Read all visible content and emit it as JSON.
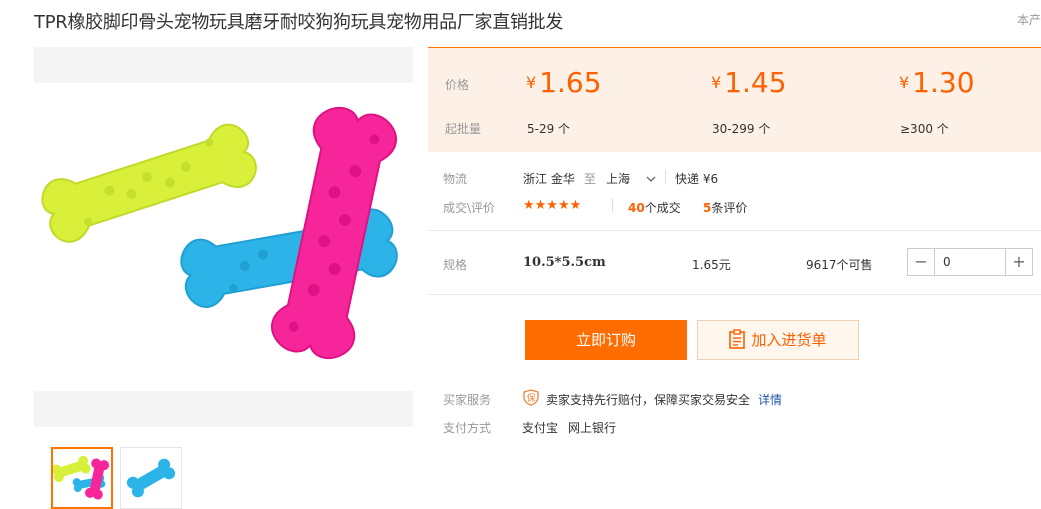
{
  "title": "TPR橡胶脚印骨头宠物玩具磨牙耐咬狗狗玩具宠物用品厂家直销批发",
  "corner_text": "本产",
  "price_panel": {
    "price_label": "价格",
    "qty_label": "起批量",
    "tiers": [
      {
        "currency": "¥",
        "price": "1.65",
        "range": "5-29 个"
      },
      {
        "currency": "¥",
        "price": "1.45",
        "range": "30-299 个"
      },
      {
        "currency": "¥",
        "price": "1.30",
        "range": "≥300 个"
      }
    ]
  },
  "logistics": {
    "label": "物流",
    "origin": "浙江 金华",
    "to": "至",
    "destination": "上海",
    "shipping": "快递 ¥6"
  },
  "trade": {
    "label": "成交\\评价",
    "stars": "★★★★★",
    "rating_value": 5,
    "deals_count": "40",
    "deals_suffix": "个成交",
    "reviews_count": "5",
    "reviews_suffix": "条评价"
  },
  "spec": {
    "label": "规格",
    "name": "10.5*5.5cm",
    "price": "1.65元",
    "available": "9617个可售",
    "quantity": "0",
    "minus": "−",
    "plus": "+"
  },
  "actions": {
    "buy_now": "立即订购",
    "add_to_cart": "加入进货单"
  },
  "buyer_service": {
    "label": "买家服务",
    "text": "卖家支持先行赔付，保障买家交易安全",
    "details_link": "详情",
    "badge_char": "保"
  },
  "payment": {
    "label": "支付方式",
    "methods": [
      "支付宝",
      "网上银行"
    ]
  },
  "colors": {
    "accent": "#ff6000",
    "price_bg": "#fdf0e7",
    "link": "#2255aa"
  },
  "icons": {
    "chevron": "chevron-down-icon",
    "cart": "clipboard-list-icon",
    "shield": "shield-icon"
  }
}
